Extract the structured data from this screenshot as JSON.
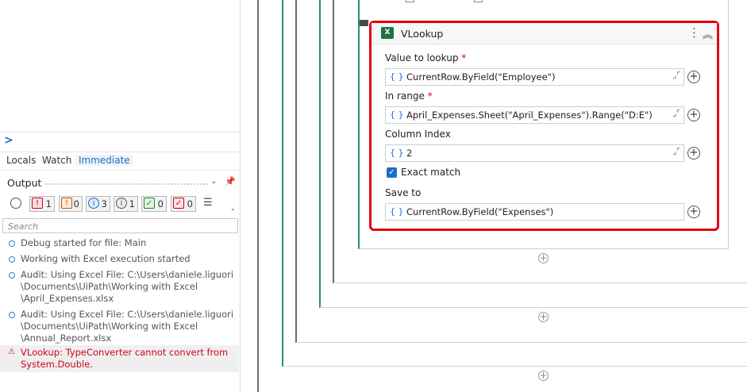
{
  "panel": {
    "prompt": ">",
    "tabs": [
      "Locals",
      "Watch",
      "Immediate"
    ],
    "output_title": "Output",
    "filters": [
      {
        "name": "error",
        "count": "1",
        "color": "#d0021b",
        "bg": "#fbe0e0",
        "glyph": "!"
      },
      {
        "name": "warning",
        "count": "0",
        "color": "#c25400",
        "bg": "#fbecdc",
        "glyph": "!"
      },
      {
        "name": "info",
        "count": "3",
        "color": "#1a6fc9",
        "bg": "#e2ecfa",
        "glyph": "i"
      },
      {
        "name": "trace",
        "count": "1",
        "color": "#555555",
        "bg": "#ececec",
        "glyph": "i"
      },
      {
        "name": "success",
        "count": "0",
        "color": "#1a8a2e",
        "bg": "#e1f3e4",
        "glyph": "✓"
      },
      {
        "name": "failed",
        "count": "0",
        "color": "#d0021b",
        "bg": "#fbe0e0",
        "glyph": "✓"
      }
    ],
    "search_placeholder": "Search",
    "logs": [
      {
        "lines": [
          "Debug started for file: Main"
        ],
        "type": "info"
      },
      {
        "lines": [
          "Working with Excel execution started"
        ],
        "type": "info"
      },
      {
        "lines": [
          "Audit: Using Excel File: C:\\Users\\daniele.liguori",
          "\\Documents\\UiPath\\Working with Excel",
          "\\April_Expenses.xlsx"
        ],
        "type": "info"
      },
      {
        "lines": [
          "Audit: Using Excel File: C:\\Users\\daniele.liguori",
          "\\Documents\\UiPath\\Working with Excel",
          "\\Annual_Report.xlsx"
        ],
        "type": "info"
      },
      {
        "lines": [
          "VLookup: TypeConverter cannot convert from",
          "System.Double."
        ],
        "type": "error"
      }
    ]
  },
  "activity": {
    "title": "VLookup",
    "icon": "excel-icon",
    "fields": [
      {
        "label": "Value to lookup",
        "required": true,
        "value": "CurrentRow.ByField(\"Employee\")",
        "expand": true
      },
      {
        "label": "In range",
        "required": true,
        "value": "April_Expenses.Sheet(\"April_Expenses\").Range(\"D:E\")",
        "expand": true
      },
      {
        "label": "Column Index",
        "required": false,
        "value": "2",
        "expand": true
      }
    ],
    "exact_match_label": "Exact match",
    "exact_match_checked": true,
    "save_to": {
      "label": "Save to",
      "value": "CurrentRow.ByField(\"Expenses\")"
    }
  },
  "colors": {
    "accent": "#1a6fc9",
    "highlight": "#e10012",
    "teal_line": "#2e8b7a",
    "excel": "#1f7244",
    "error": "#d0021b"
  }
}
